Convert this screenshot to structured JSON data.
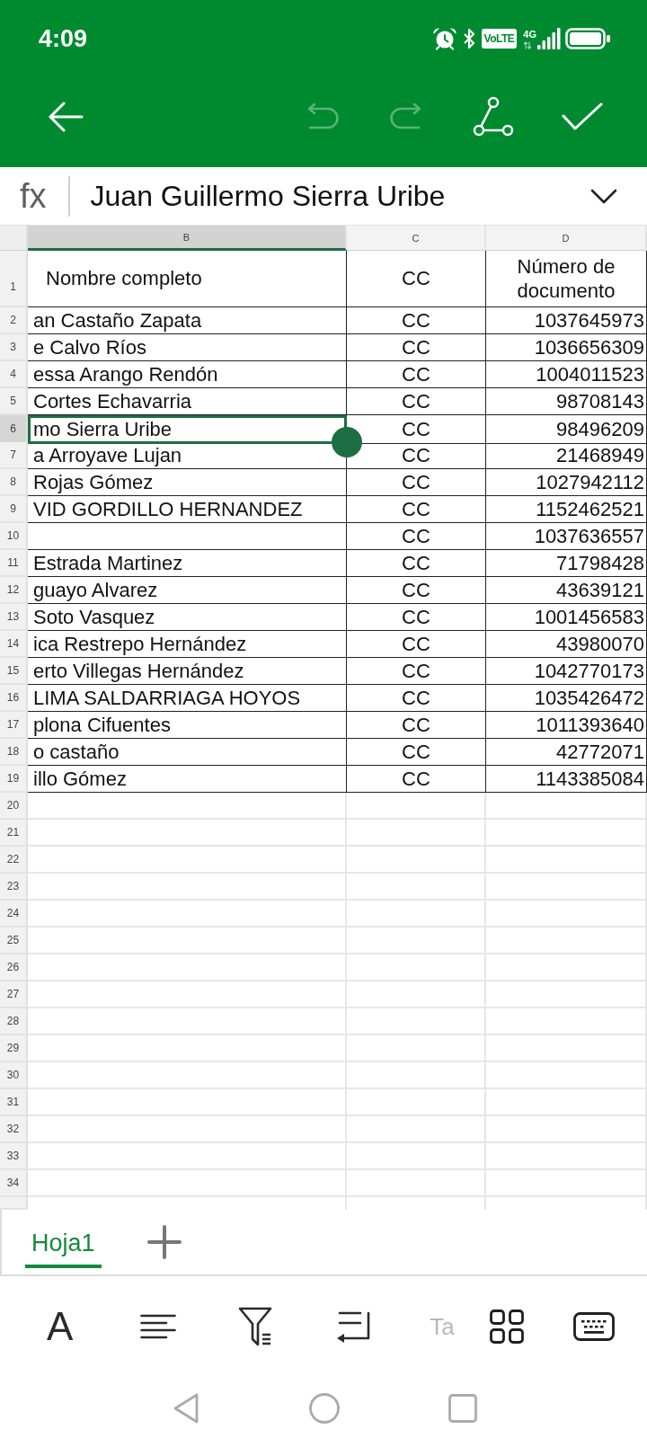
{
  "status_bar": {
    "time": "4:09",
    "network_badge": "VoLTE",
    "network_type": "4G"
  },
  "toolbar": [
    {
      "kind": "back",
      "disabled": false
    },
    {
      "kind": "undo",
      "disabled": true
    },
    {
      "kind": "redo",
      "disabled": true
    },
    {
      "kind": "connect",
      "disabled": false
    },
    {
      "kind": "confirm",
      "disabled": false
    }
  ],
  "formula_bar": {
    "label": "fx",
    "value": "Juan Guillermo Sierra Uribe"
  },
  "sheet": {
    "columns": [
      {
        "label": "B",
        "selected": true
      },
      {
        "label": "C",
        "selected": false
      },
      {
        "label": "D",
        "selected": false
      }
    ],
    "rows": [
      {
        "number": "1",
        "kind": "header",
        "selected": false,
        "b": "Nombre completo",
        "c": "CC",
        "d": "Número de documento"
      },
      {
        "number": "2",
        "kind": "data",
        "selected": false,
        "b": "an Castaño Zapata",
        "c": "CC",
        "d": "1037645973"
      },
      {
        "number": "3",
        "kind": "data",
        "selected": false,
        "b": "e Calvo Ríos",
        "c": "CC",
        "d": "1036656309"
      },
      {
        "number": "4",
        "kind": "data",
        "selected": false,
        "b": "essa Arango Rendón",
        "c": "CC",
        "d": "1004011523"
      },
      {
        "number": "5",
        "kind": "data",
        "selected": false,
        "b": "Cortes Echavarria",
        "c": "CC",
        "d": "98708143"
      },
      {
        "number": "6",
        "kind": "data",
        "selected": true,
        "b": "mo Sierra Uribe",
        "c": "CC",
        "d": "98496209"
      },
      {
        "number": "7",
        "kind": "data",
        "selected": false,
        "b": "a Arroyave Lujan",
        "c": "CC",
        "d": "21468949"
      },
      {
        "number": "8",
        "kind": "data",
        "selected": false,
        "b": "Rojas Gómez",
        "c": "CC",
        "d": "1027942112"
      },
      {
        "number": "9",
        "kind": "data",
        "selected": false,
        "b": "VID GORDILLO HERNANDEZ",
        "c": "CC",
        "d": "1152462521"
      },
      {
        "number": "10",
        "kind": "data",
        "selected": false,
        "c": "CC",
        "d": "1037636557"
      },
      {
        "number": "11",
        "kind": "data",
        "selected": false,
        "b": "Estrada Martinez",
        "c": "CC",
        "d": "71798428"
      },
      {
        "number": "12",
        "kind": "data",
        "selected": false,
        "b": "guayo Alvarez",
        "c": "CC",
        "d": "43639121"
      },
      {
        "number": "13",
        "kind": "data",
        "selected": false,
        "b": "Soto Vasquez",
        "c": "CC",
        "d": "1001456583"
      },
      {
        "number": "14",
        "kind": "data",
        "selected": false,
        "b": "ica Restrepo Hernández",
        "c": "CC",
        "d": "43980070"
      },
      {
        "number": "15",
        "kind": "data",
        "selected": false,
        "b": "erto Villegas Hernández",
        "c": "CC",
        "d": "1042770173"
      },
      {
        "number": "16",
        "kind": "data",
        "selected": false,
        "b": "LIMA SALDARRIAGA HOYOS",
        "c": "CC",
        "d": "1035426472"
      },
      {
        "number": "17",
        "kind": "data",
        "selected": false,
        "b": "plona Cifuentes",
        "c": "CC",
        "d": "1011393640"
      },
      {
        "number": "18",
        "kind": "data",
        "selected": false,
        "b": "o castaño",
        "c": "CC",
        "d": "42772071"
      },
      {
        "number": "19",
        "kind": "data",
        "selected": false,
        "b": "illo Gómez",
        "c": "CC",
        "d": "1143385084"
      },
      {
        "number": "20",
        "kind": "blank",
        "selected": false
      },
      {
        "number": "21",
        "kind": "blank",
        "selected": false
      },
      {
        "number": "22",
        "kind": "blank",
        "selected": false
      },
      {
        "number": "23",
        "kind": "blank",
        "selected": false
      },
      {
        "number": "24",
        "kind": "blank",
        "selected": false
      },
      {
        "number": "25",
        "kind": "blank",
        "selected": false
      },
      {
        "number": "26",
        "kind": "blank",
        "selected": false
      },
      {
        "number": "27",
        "kind": "blank",
        "selected": false
      },
      {
        "number": "28",
        "kind": "blank",
        "selected": false
      },
      {
        "number": "29",
        "kind": "blank",
        "selected": false
      },
      {
        "number": "30",
        "kind": "blank",
        "selected": false
      },
      {
        "number": "31",
        "kind": "blank",
        "selected": false
      },
      {
        "number": "32",
        "kind": "blank",
        "selected": false
      },
      {
        "number": "33",
        "kind": "blank",
        "selected": false
      },
      {
        "number": "34",
        "kind": "blank",
        "selected": false
      }
    ]
  },
  "sheet_tabs": [
    {
      "label": "Hoja1",
      "selected": true
    }
  ],
  "bottom_toolbar": [
    {
      "kind": "font",
      "glyph": "A",
      "disabled": false
    },
    {
      "kind": "align",
      "disabled": false
    },
    {
      "kind": "filter",
      "disabled": false
    },
    {
      "kind": "wrap",
      "disabled": false
    },
    {
      "kind": "text_style",
      "glyph": "Ta",
      "disabled": true
    },
    {
      "kind": "grid",
      "disabled": false
    },
    {
      "kind": "keyboard",
      "disabled": false
    }
  ]
}
